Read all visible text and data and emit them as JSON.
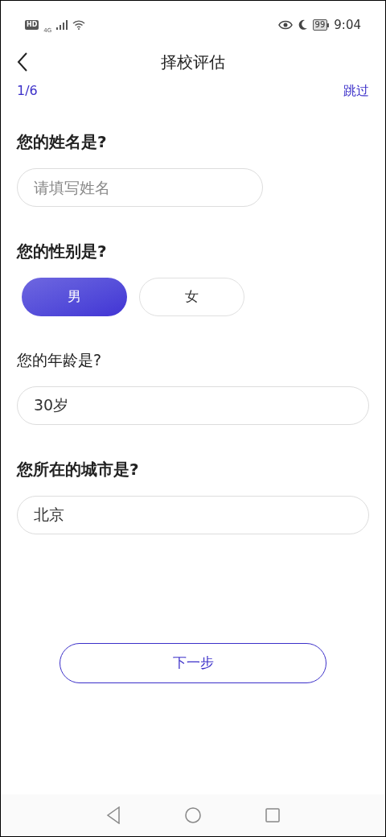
{
  "status_bar": {
    "left": [
      "HD",
      "4G"
    ],
    "battery": "99",
    "time": "9:04"
  },
  "header": {
    "title": "择校评估"
  },
  "progress": {
    "step": "1/6",
    "skip": "跳过"
  },
  "questions": [
    {
      "kind": "text",
      "label": "您的姓名是?",
      "emphasized": true,
      "placeholder": "请填写姓名",
      "narrow": true
    },
    {
      "kind": "choice",
      "label": "您的性别是?",
      "emphasized": true,
      "options": [
        {
          "label": "男",
          "selected": true
        },
        {
          "label": "女",
          "selected": false
        }
      ]
    },
    {
      "kind": "text",
      "label": "您的年龄是?",
      "emphasized": false,
      "value": "30岁",
      "narrow": false
    },
    {
      "kind": "text",
      "label": "您所在的城市是?",
      "emphasized": true,
      "value": "北京",
      "narrow": false
    }
  ],
  "next_button": "下一步"
}
